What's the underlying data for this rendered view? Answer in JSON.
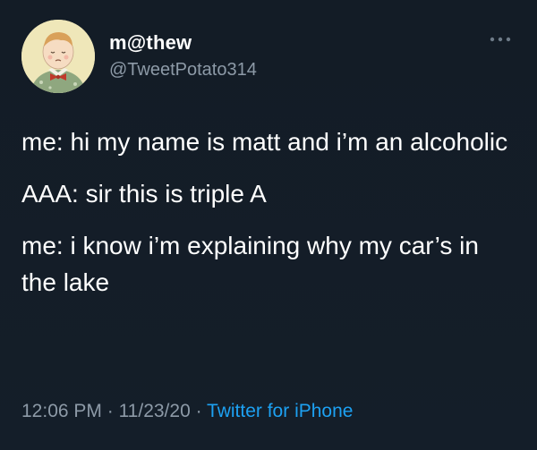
{
  "author": {
    "display_name": "m@thew",
    "handle": "@TweetPotato314",
    "avatar_icon": "profile-avatar-illustration"
  },
  "more_icon": "more-options-icon",
  "tweet": {
    "lines": [
      "me: hi my name is matt and i’m an alcoholic",
      "AAA: sir this is triple A",
      "me: i know i’m explaining why my car’s in the lake"
    ]
  },
  "meta": {
    "time": "12:06 PM",
    "separator": " · ",
    "date": "11/23/20",
    "source": "Twitter for iPhone"
  },
  "colors": {
    "background": "#15202b",
    "secondary_text": "#8d9aa7",
    "link": "#1da1f2"
  }
}
